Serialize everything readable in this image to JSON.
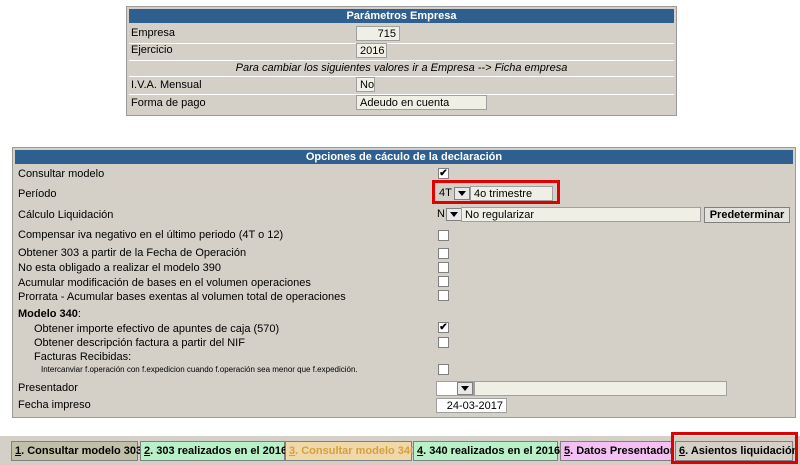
{
  "empresa_panel": {
    "title": "Parámetros Empresa",
    "empresa_label": "Empresa",
    "empresa_value": "715",
    "ejercicio_label": "Ejercicio",
    "ejercicio_value": "2016",
    "note": "Para cambiar los siguientes valores ir a Empresa --> Ficha empresa",
    "iva_label": "I.V.A. Mensual",
    "iva_value": "No",
    "forma_label": "Forma de pago",
    "forma_value": "Adeudo en cuenta"
  },
  "opciones_panel": {
    "title": "Opciones de cáculo de la declaración",
    "consultar_label": "Consultar modelo",
    "consultar_checked": true,
    "periodo_label": "Período",
    "periodo_code": "4T",
    "periodo_text": "4o trimestre",
    "calculo_label": "Cálculo Liquidación",
    "calculo_code": "N",
    "calculo_text": "No regularizar",
    "predeterminar_label": "Predeterminar",
    "compensar_label": "Compensar iva negativo en el último periodo (4T o 12)",
    "obtener303_label": "Obtener 303 a partir de la Fecha de Operación",
    "no390_label": "No esta obligado a realizar el modelo 390",
    "acumular_label": "Acumular modificación de bases en el volumen operaciones",
    "prorrata_label": "Prorrata - Acumular bases exentas al volumen total de operaciones",
    "modelo340_label": "Modelo 340",
    "modelo340_colon": ":",
    "importe570_label": "Obtener importe efectivo de apuntes de caja (570)",
    "importe570_checked": true,
    "descripcion_label": "Obtener descripción factura a partir del NIF",
    "facturas_label": "Facturas Recibidas:",
    "intercambiar_label": "Intercanviar f.operación con f.expedicion cuando f.operación sea menor que f.expedición.",
    "presentador_label": "Presentador",
    "fecha_label": "Fecha impreso",
    "fecha_value": "24-03-2017"
  },
  "tabs": [
    {
      "num": "1",
      "label": ". Consultar modelo 303",
      "bg": "#c0c0a8",
      "color": "#000000"
    },
    {
      "num": "2",
      "label": ". 303 realizados en el 2016",
      "bg": "#b8f0c8",
      "color": "#000000"
    },
    {
      "num": "3",
      "label": ". Consultar modelo 340",
      "bg": "#f0d8a8",
      "color": "#d4a040"
    },
    {
      "num": "4",
      "label": ". 340 realizados en el 2016",
      "bg": "#b8f0c8",
      "color": "#000000"
    },
    {
      "num": "5",
      "label": ". Datos Presentador",
      "bg": "#f4c0f4",
      "color": "#000000"
    },
    {
      "num": "6",
      "label": ". Asientos liquidación",
      "bg": "#d4d0c8",
      "color": "#000000"
    }
  ],
  "colors": {
    "header": "#2f5f8e",
    "highlight": "#e00000",
    "panel": "#d4d0c8"
  },
  "icons": {
    "check": "✔"
  }
}
